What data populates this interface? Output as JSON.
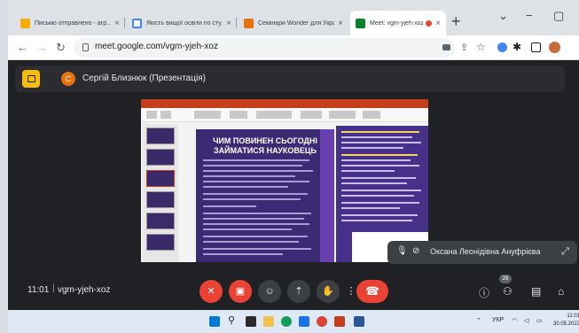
{
  "browser": {
    "tabs": [
      {
        "title": "Письмо отправлено - агр...",
        "favicon_color": "#f9ab00",
        "active": false
      },
      {
        "title": "Якість вищої освіти по сту...",
        "favicon_color": "#4285f4",
        "active": false
      },
      {
        "title": "Семінари Wonder для Укра...",
        "favicon_color": "#e8710a",
        "active": false
      },
      {
        "title": "Meet: vgm-yjeh-xoz",
        "favicon_color": "#00832d",
        "active": true
      }
    ],
    "new_tab": "+",
    "window_controls": {
      "chevron": "⌄",
      "minimize": "−",
      "maximize": "▢"
    },
    "url": "meet.google.com/vgm-yjeh-xoz"
  },
  "meet": {
    "presenter_initial": "С",
    "presenter_title": "Сергій Близнюк (Презентація)",
    "slide_heading": "ЧИМ ПОВИНЕН СЬОГОДНІ ЗАЙМАТИСЯ НАУКОВЕЦЬ",
    "pip_name": "Оксана Леонідівна Ануфрієва",
    "time": "11:01",
    "meeting_code": "vgm-yjeh-xoz",
    "participants_count": "28"
  },
  "taskbar": {
    "lang": "УКР",
    "time": "11:01",
    "date": "30.05.2022"
  },
  "colors": {
    "meet_bg": "#202124",
    "red_button": "#ea4335",
    "accent_yellow": "#fbbc04"
  }
}
